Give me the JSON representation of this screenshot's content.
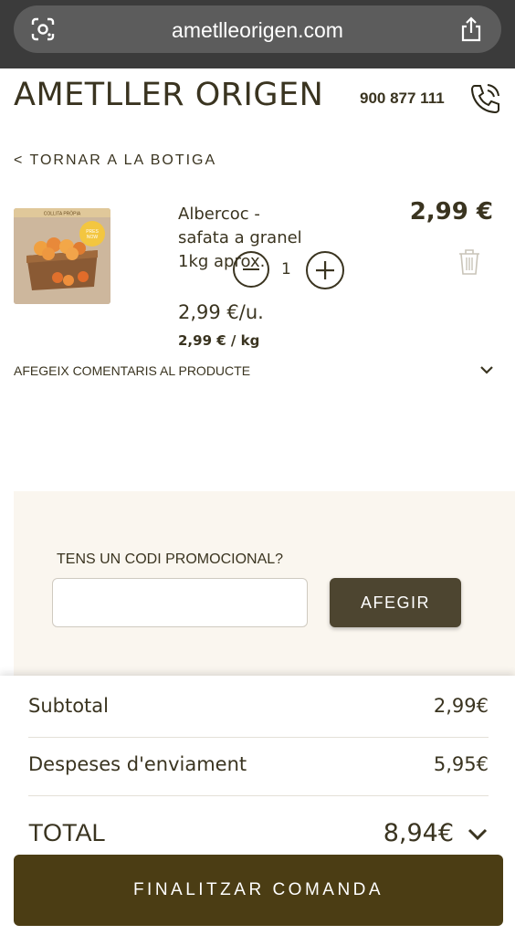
{
  "browser": {
    "url": "ametlleorigen.com",
    "lens_icon": "camera-lens-icon",
    "share_icon": "share-icon"
  },
  "header": {
    "logo": "AMETLLER ORIGEN",
    "phone": "900 877 111",
    "phone_icon": "phone-icon"
  },
  "nav": {
    "back_link": "< TORNAR A LA BOTIGA"
  },
  "cart": {
    "items": [
      {
        "name": "Albercoc - safata a granel 1kg aprox.",
        "price": "2,99 €",
        "quantity": "1",
        "unit_price": "2,99 €/u.",
        "kg_price": "2,99 € / kg",
        "image_label_top": "COLLITA PRÒPIA",
        "image_badge": "PRESS NOW",
        "image_badge_line1": "PRES",
        "image_badge_line2": "NOW"
      }
    ],
    "comments_link": "AFEGEIX COMENTARIS AL PRODUCTE"
  },
  "promo": {
    "label": "TENS UN CODI PROMOCIONAL?",
    "input_value": "",
    "button_label": "AFEGIR"
  },
  "summary": {
    "subtotal_label": "Subtotal",
    "subtotal_value": "2,99€",
    "shipping_label": "Despeses d'enviament",
    "shipping_value": "5,95€",
    "total_label": "TOTAL",
    "total_value": "8,94€",
    "checkout_label": "FINALITZAR COMANDA"
  },
  "colors": {
    "brand_dark": "#3a3420",
    "checkout_bg": "#4b3d14",
    "promo_bg": "#faf6ef",
    "browser_bg": "#3b3b3b"
  }
}
